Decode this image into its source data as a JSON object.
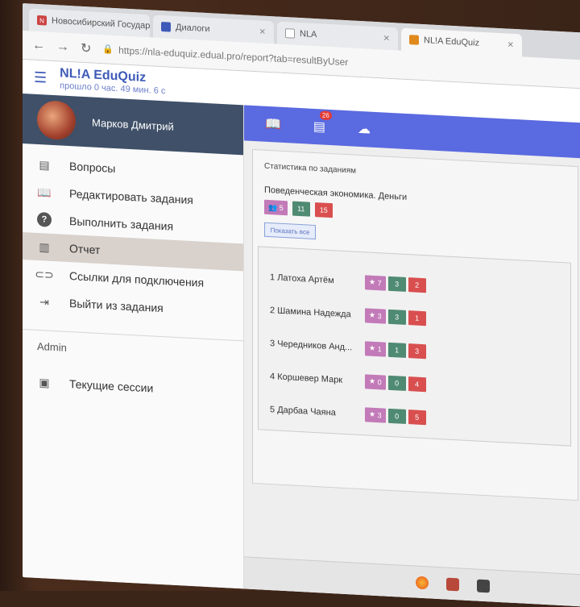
{
  "browser": {
    "tabs": [
      {
        "label": "Новосибирский Государ",
        "icon": "n-logo-icon"
      },
      {
        "label": "Диалоги",
        "icon": "chat-icon"
      },
      {
        "label": "NLA",
        "icon": "document-icon"
      },
      {
        "label": "NL!A EduQuiz",
        "icon": "quiz-icon"
      }
    ],
    "url": "https://nla-eduquiz.edual.pro/report?tab=resultByUser"
  },
  "app": {
    "title": "NL!A EduQuiz",
    "subtitle": "прошло 0 час. 49 мин. 6 с"
  },
  "sidebar": {
    "user_name": "Марков Дмитрий",
    "items": [
      {
        "label": "Вопросы",
        "icon": "list-icon"
      },
      {
        "label": "Редактировать задания",
        "icon": "book-reader-icon"
      },
      {
        "label": "Выполнить задания",
        "icon": "question-icon"
      },
      {
        "label": "Отчет",
        "icon": "bar-chart-icon"
      },
      {
        "label": "Ссылки для подключения",
        "icon": "link-icon"
      },
      {
        "label": "Выйти из задания",
        "icon": "exit-icon"
      }
    ],
    "admin_label": "Admin",
    "admin_items": [
      {
        "label": "Текущие сессии",
        "icon": "sessions-icon"
      }
    ]
  },
  "toolbar": {
    "badge": "26"
  },
  "report": {
    "title": "Статистика по заданиям",
    "task_name": "Поведенческая экономика. Деньги",
    "stats": {
      "participants": "5",
      "correct": "11",
      "wrong": "15"
    },
    "more_button": "Показать все",
    "results": [
      {
        "rank": "1",
        "name": "Латоха Артём",
        "stars": "7",
        "correct": "3",
        "wrong": "2"
      },
      {
        "rank": "2",
        "name": "Шамина Надежда",
        "stars": "3",
        "correct": "3",
        "wrong": "1"
      },
      {
        "rank": "3",
        "name": "Чередников Анд...",
        "stars": "1",
        "correct": "1",
        "wrong": "3"
      },
      {
        "rank": "4",
        "name": "Коршевер Марк",
        "stars": "0",
        "correct": "0",
        "wrong": "4"
      },
      {
        "rank": "5",
        "name": "Дарбаа Чаяна",
        "stars": "3",
        "correct": "0",
        "wrong": "5"
      }
    ]
  }
}
